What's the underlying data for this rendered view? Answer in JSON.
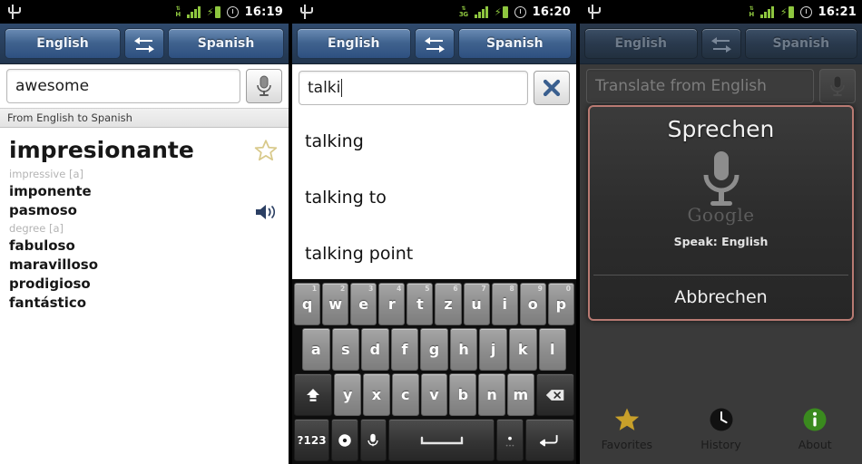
{
  "panels": [
    {
      "status": {
        "time": "16:19",
        "network": "H",
        "usb_icon": "usb-icon",
        "signal_icon": "signal-bars-icon",
        "battery_icon": "battery-charging-icon",
        "alarm_icon": "alarm-clock-icon"
      },
      "langbar": {
        "source": "English",
        "target": "Spanish",
        "swap_icon": "swap-arrows-icon"
      },
      "input": {
        "value": "awesome",
        "placeholder": "",
        "action_icon": "microphone-icon"
      },
      "subtitle": "From English to Spanish",
      "result": {
        "headword": "impresionante",
        "star_icon": "star-outline-icon",
        "speaker_icon": "speaker-icon",
        "entries": [
          {
            "type": "sense",
            "text": "impressive [a]"
          },
          {
            "type": "term",
            "text": "imponente"
          },
          {
            "type": "term",
            "text": "pasmoso"
          },
          {
            "type": "sense",
            "text": "degree [a]"
          },
          {
            "type": "term",
            "text": "fabuloso"
          },
          {
            "type": "term",
            "text": "maravilloso"
          },
          {
            "type": "term",
            "text": "prodigioso"
          },
          {
            "type": "term",
            "text": "fantástico"
          }
        ]
      }
    },
    {
      "status": {
        "time": "16:20",
        "network": "3G"
      },
      "langbar": {
        "source": "English",
        "target": "Spanish",
        "swap_icon": "swap-arrows-icon"
      },
      "input": {
        "value": "talki",
        "placeholder": "",
        "action_icon": "clear-x-icon"
      },
      "suggestions": [
        "talking",
        "talking to",
        "talking point"
      ],
      "keyboard": {
        "rows": [
          [
            {
              "label": "q",
              "num": "1"
            },
            {
              "label": "w",
              "num": "2"
            },
            {
              "label": "e",
              "num": "3"
            },
            {
              "label": "r",
              "num": "4"
            },
            {
              "label": "t",
              "num": "5"
            },
            {
              "label": "z",
              "num": "6"
            },
            {
              "label": "u",
              "num": "7"
            },
            {
              "label": "i",
              "num": "8"
            },
            {
              "label": "o",
              "num": "9"
            },
            {
              "label": "p",
              "num": "0"
            }
          ],
          [
            {
              "label": "a"
            },
            {
              "label": "s"
            },
            {
              "label": "d"
            },
            {
              "label": "f"
            },
            {
              "label": "g"
            },
            {
              "label": "h"
            },
            {
              "label": "j"
            },
            {
              "label": "k"
            },
            {
              "label": "l"
            }
          ],
          [
            {
              "label": "",
              "icon": "shift-icon"
            },
            {
              "label": "y"
            },
            {
              "label": "x"
            },
            {
              "label": "c"
            },
            {
              "label": "v"
            },
            {
              "label": "b"
            },
            {
              "label": "n"
            },
            {
              "label": "m"
            },
            {
              "label": "",
              "icon": "backspace-icon"
            }
          ],
          [
            {
              "label": "?123"
            },
            {
              "label": "",
              "icon": "settings-icon"
            },
            {
              "label": "",
              "icon": "mic-key-icon"
            },
            {
              "label": "",
              "icon": "space-icon"
            },
            {
              "label": ".",
              "icon": "period-icon"
            },
            {
              "label": "",
              "icon": "enter-icon"
            }
          ]
        ]
      }
    },
    {
      "status": {
        "time": "16:21",
        "network": "H"
      },
      "langbar": {
        "source": "English",
        "target": "Spanish",
        "swap_icon": "swap-arrows-icon"
      },
      "input": {
        "value": "",
        "placeholder": "Translate from English",
        "action_icon": "microphone-icon"
      },
      "dialog": {
        "title": "Sprechen",
        "mic_icon": "microphone-large-icon",
        "watermark": "Google",
        "speak_label": "Speak: English",
        "cancel_label": "Abbrechen",
        "border_color": "#b87a72"
      },
      "tabs": [
        {
          "label": "Favorites",
          "icon": "star-filled-icon",
          "color": "#c8a02a"
        },
        {
          "label": "History",
          "icon": "clock-icon",
          "color": "#111111"
        },
        {
          "label": "About",
          "icon": "info-icon",
          "color": "#3a8a1e"
        }
      ]
    }
  ]
}
